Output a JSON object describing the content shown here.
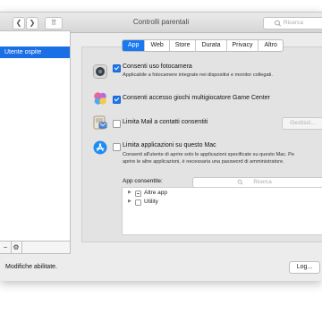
{
  "window": {
    "title": "Controlli parentali",
    "search_placeholder": "Ricerca"
  },
  "toolbar": {
    "back": "❮",
    "forward": "❯",
    "grid": "⠿"
  },
  "sidebar": {
    "items": [
      {
        "label": "Utente ospite",
        "selected": true
      }
    ],
    "add": "+",
    "remove": "−",
    "gear": "⚙"
  },
  "tabs": [
    {
      "label": "App",
      "active": true
    },
    {
      "label": "Web",
      "active": false
    },
    {
      "label": "Store",
      "active": false
    },
    {
      "label": "Durata",
      "active": false
    },
    {
      "label": "Privacy",
      "active": false
    },
    {
      "label": "Altro",
      "active": false
    }
  ],
  "settings": [
    {
      "label": "Consenti uso fotocamera",
      "checked": true,
      "description": [
        "Applicabile a fotocamere integrate nei dispositivi e monitor collegati."
      ]
    },
    {
      "label": "Consenti accesso giochi multigiocatore Game Center",
      "checked": true,
      "description": []
    },
    {
      "label": "Limita Mail a contatti consentiti",
      "checked": false,
      "description": [],
      "button": "Gestisci..."
    },
    {
      "label": "Limita applicazioni su questo Mac",
      "checked": false,
      "description": [
        "Consenti all'utente di aprire solo le applicazioni specificate su questo Mac. Pe",
        "aprire le altre applicazioni, è necessaria una password di amministratore."
      ]
    }
  ],
  "apps": {
    "label": "App consentite:",
    "search_placeholder": "Ricerca",
    "items": [
      {
        "label": "Altre app",
        "mixed": true
      },
      {
        "label": "Utility",
        "mixed": false
      }
    ]
  },
  "status": {
    "text": "Modifiche abilitate.",
    "log_button": "Log..."
  },
  "colors": {
    "accent": "#1a78f0",
    "sidebar_selection": "#1a6ee6"
  }
}
